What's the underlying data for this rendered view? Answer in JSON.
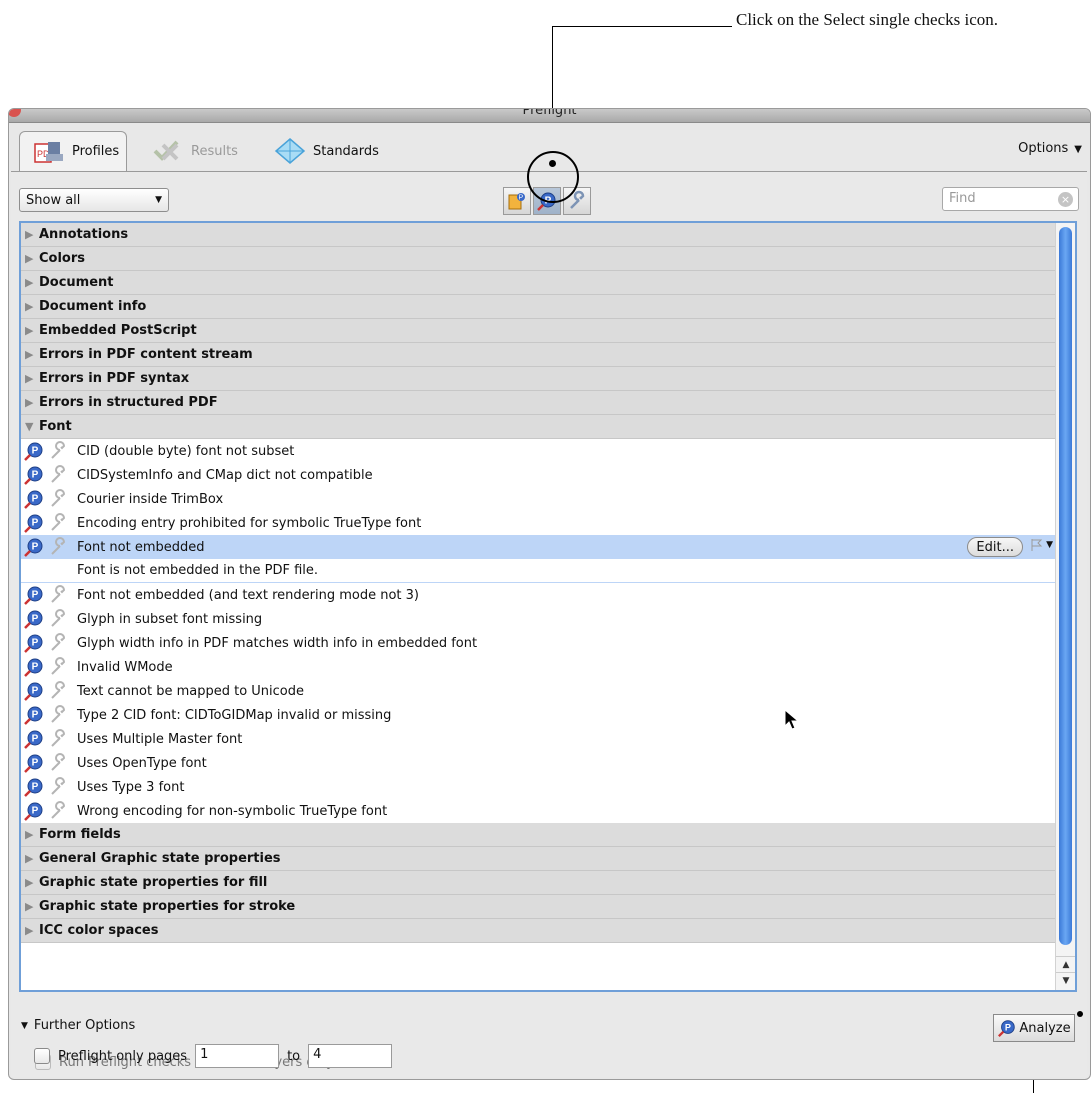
{
  "annotation": {
    "callout_text": "Click on the Select single checks icon."
  },
  "window": {
    "title": "Preflight",
    "tabs": [
      {
        "label": "Profiles",
        "icon": "profiles-icon",
        "state": "active"
      },
      {
        "label": "Results",
        "icon": "results-icon",
        "state": "disabled"
      },
      {
        "label": "Standards",
        "icon": "standards-icon",
        "state": "normal"
      }
    ],
    "options_label": "Options"
  },
  "toolbar": {
    "show_select_value": "Show all",
    "find_placeholder": "Find",
    "tool_icons": [
      "select-profiles-icon",
      "select-single-checks-icon",
      "select-single-fixups-icon"
    ]
  },
  "list": {
    "groups_before": [
      "Annotations",
      "Colors",
      "Document",
      "Document info",
      "Embedded PostScript",
      "Errors in PDF content stream",
      "Errors in PDF syntax",
      "Errors in structured PDF"
    ],
    "expanded_group": "Font",
    "font_items": [
      "CID (double byte) font not subset",
      "CIDSystemInfo and CMap dict not compatible",
      "Courier inside TrimBox",
      "Encoding entry prohibited for symbolic TrueType font",
      "Font not embedded",
      "Font not embedded (and text rendering mode not 3)",
      "Glyph in subset font missing",
      "Glyph width info in PDF matches width info in embedded font",
      "Invalid WMode",
      "Text cannot be mapped to Unicode",
      "Type 2 CID font: CIDToGIDMap invalid or missing",
      "Uses Multiple Master font",
      "Uses OpenType font",
      "Uses Type 3 font",
      "Wrong encoding for non-symbolic TrueType font"
    ],
    "selected_item": "Font not embedded",
    "selected_description": "Font is not embedded in the PDF file.",
    "edit_label": "Edit...",
    "groups_after": [
      "Form fields",
      "General Graphic state properties",
      "Graphic state properties for fill",
      "Graphic state properties for stroke",
      "ICC color spaces"
    ]
  },
  "bottom": {
    "further_options_label": "Further Options",
    "analyze_label": "Analyze",
    "visible_layers_label": "Run Preflight checks for visible layers only",
    "pages_label": "Preflight only pages",
    "pages_from": "1",
    "pages_to_label": "to",
    "pages_to": "4"
  }
}
